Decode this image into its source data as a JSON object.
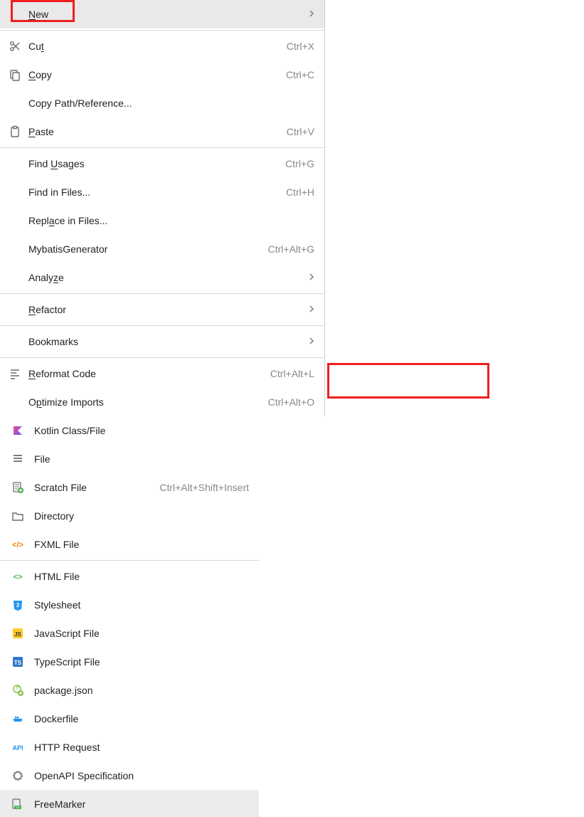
{
  "left": {
    "items": [
      {
        "id": "new",
        "label": "New",
        "underline_index": 0,
        "icon": null,
        "shortcut": null,
        "chevron": true,
        "highlighted": true
      },
      {
        "type": "sep"
      },
      {
        "id": "cut",
        "label": "Cut",
        "underline_index": 2,
        "icon": "scissors",
        "shortcut": "Ctrl+X"
      },
      {
        "id": "copy",
        "label": "Copy",
        "underline_index": 0,
        "icon": "copy",
        "shortcut": "Ctrl+C"
      },
      {
        "id": "copypath",
        "label": "Copy Path/Reference...",
        "underline_index": null,
        "icon": null,
        "shortcut": null
      },
      {
        "id": "paste",
        "label": "Paste",
        "underline_index": 0,
        "icon": "clipboard",
        "shortcut": "Ctrl+V"
      },
      {
        "type": "sep"
      },
      {
        "id": "findusages",
        "label": "Find Usages",
        "underline_index": 5,
        "icon": null,
        "shortcut": "Ctrl+G"
      },
      {
        "id": "findinfiles",
        "label": "Find in Files...",
        "underline_index": null,
        "icon": null,
        "shortcut": "Ctrl+H"
      },
      {
        "id": "replaceinfiles",
        "label": "Replace in Files...",
        "underline_index": 4,
        "icon": null,
        "shortcut": null
      },
      {
        "id": "mybatisgen",
        "label": "MybatisGenerator",
        "underline_index": null,
        "icon": null,
        "shortcut": "Ctrl+Alt+G"
      },
      {
        "id": "analyze",
        "label": "Analyze",
        "underline_index": 5,
        "icon": null,
        "shortcut": null,
        "chevron": true
      },
      {
        "type": "sep"
      },
      {
        "id": "refactor",
        "label": "Refactor",
        "underline_index": 0,
        "icon": null,
        "shortcut": null,
        "chevron": true
      },
      {
        "type": "sep"
      },
      {
        "id": "bookmarks",
        "label": "Bookmarks",
        "underline_index": null,
        "icon": null,
        "shortcut": null,
        "chevron": true
      },
      {
        "type": "sep"
      },
      {
        "id": "reformat",
        "label": "Reformat Code",
        "underline_index": 0,
        "icon": "reformat",
        "shortcut": "Ctrl+Alt+L"
      },
      {
        "id": "optimize",
        "label": "Optimize Imports",
        "underline_index": 1,
        "icon": null,
        "shortcut": "Ctrl+Alt+O"
      }
    ]
  },
  "right": {
    "items": [
      {
        "id": "kotlin",
        "label": "Kotlin Class/File",
        "icon": "kotlin"
      },
      {
        "id": "file",
        "label": "File",
        "icon": "file-lines"
      },
      {
        "id": "scratch",
        "label": "Scratch File",
        "icon": "scratch",
        "shortcut": "Ctrl+Alt+Shift+Insert"
      },
      {
        "id": "directory",
        "label": "Directory",
        "icon": "folder"
      },
      {
        "id": "fxml",
        "label": "FXML File",
        "icon": "fxml"
      },
      {
        "type": "sep"
      },
      {
        "id": "html",
        "label": "HTML File",
        "icon": "html"
      },
      {
        "id": "stylesheet",
        "label": "Stylesheet",
        "icon": "css"
      },
      {
        "id": "js",
        "label": "JavaScript File",
        "icon": "js"
      },
      {
        "id": "ts",
        "label": "TypeScript File",
        "icon": "ts"
      },
      {
        "id": "packagejson",
        "label": "package.json",
        "icon": "npm"
      },
      {
        "id": "dockerfile",
        "label": "Dockerfile",
        "icon": "docker"
      },
      {
        "id": "http",
        "label": "HTTP Request",
        "icon": "api"
      },
      {
        "id": "openapi",
        "label": "OpenAPI Specification",
        "icon": "openapi"
      },
      {
        "id": "freemarker",
        "label": "FreeMarker",
        "icon": "freemarker",
        "selected": true
      }
    ]
  }
}
